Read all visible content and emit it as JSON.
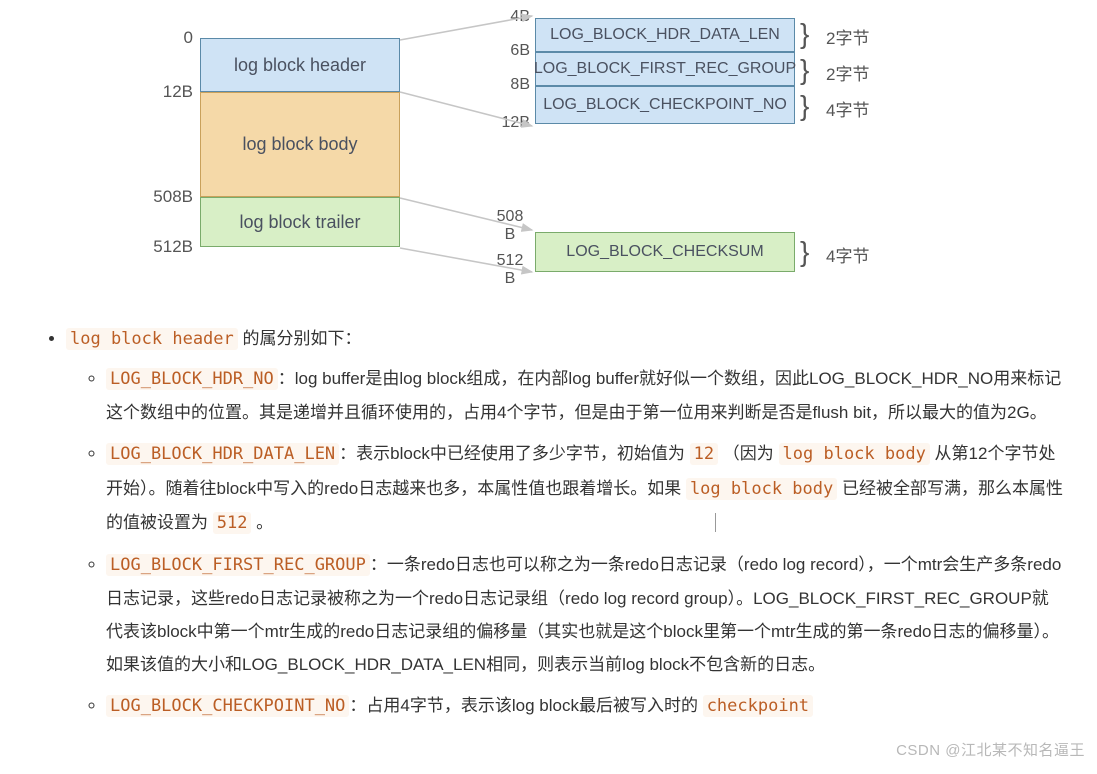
{
  "diagram": {
    "left_offsets": [
      "0",
      "12B",
      "508B",
      "512B"
    ],
    "left_blocks": {
      "header": "log block header",
      "body": "log block body",
      "trailer": "log block trailer"
    },
    "header_fields": {
      "offsets": [
        "4B",
        "6B",
        "8B",
        "12B"
      ],
      "rows": [
        {
          "name": "LOG_BLOCK_HDR_DATA_LEN",
          "size": "2字节"
        },
        {
          "name": "LOG_BLOCK_FIRST_REC_GROUP",
          "size": "2字节"
        },
        {
          "name": "LOG_BLOCK_CHECKPOINT_NO",
          "size": "4字节"
        }
      ]
    },
    "trailer_fields": {
      "offsets": [
        "508 B",
        "512 B"
      ],
      "rows": [
        {
          "name": "LOG_BLOCK_CHECKSUM",
          "size": "4字节"
        }
      ]
    }
  },
  "content": {
    "intro_code": "log block header",
    "intro_rest": " 的属分别如下：",
    "items": [
      {
        "code": "LOG_BLOCK_HDR_NO",
        "segments": [
          {
            "t": "text",
            "v": "：log buffer是由log block组成，在内部log buffer就好似一个数组，因此LOG_BLOCK_HDR_NO用来标记这个数组中的位置。其是递增并且循环使用的，占用4个字节，但是由于第一位用来判断是否是flush bit，所以最大的值为2G。"
          }
        ]
      },
      {
        "code": "LOG_BLOCK_HDR_DATA_LEN",
        "segments": [
          {
            "t": "text",
            "v": "：表示block中已经使用了多少字节，初始值为 "
          },
          {
            "t": "code",
            "v": "12"
          },
          {
            "t": "text",
            "v": " （因为 "
          },
          {
            "t": "code",
            "v": "log block body"
          },
          {
            "t": "text",
            "v": " 从第12个字节处开始）。随着往block中写入的redo日志越来也多，本属性值也跟着增长。如果 "
          },
          {
            "t": "code",
            "v": "log block body"
          },
          {
            "t": "text",
            "v": " 已经被全部写满，那么本属性的值被设置为 "
          },
          {
            "t": "code",
            "v": "512"
          },
          {
            "t": "text",
            "v": " 。"
          }
        ]
      },
      {
        "code": "LOG_BLOCK_FIRST_REC_GROUP",
        "segments": [
          {
            "t": "text",
            "v": "：一条redo日志也可以称之为一条redo日志记录（redo log record），一个mtr会生产多条redo日志记录，这些redo日志记录被称之为一个redo日志记录组（redo log record group）。LOG_BLOCK_FIRST_REC_GROUP就代表该block中第一个mtr生成的redo日志记录组的偏移量（其实也就是这个block里第一个mtr生成的第一条redo日志的偏移量）。如果该值的大小和LOG_BLOCK_HDR_DATA_LEN相同，则表示当前log block不包含新的日志。"
          }
        ]
      },
      {
        "code": "LOG_BLOCK_CHECKPOINT_NO",
        "segments": [
          {
            "t": "text",
            "v": "：占用4字节，表示该log block最后被写入时的 "
          },
          {
            "t": "code",
            "v": "checkpoint"
          }
        ]
      }
    ]
  },
  "watermark": "CSDN @江北某不知名逼王"
}
